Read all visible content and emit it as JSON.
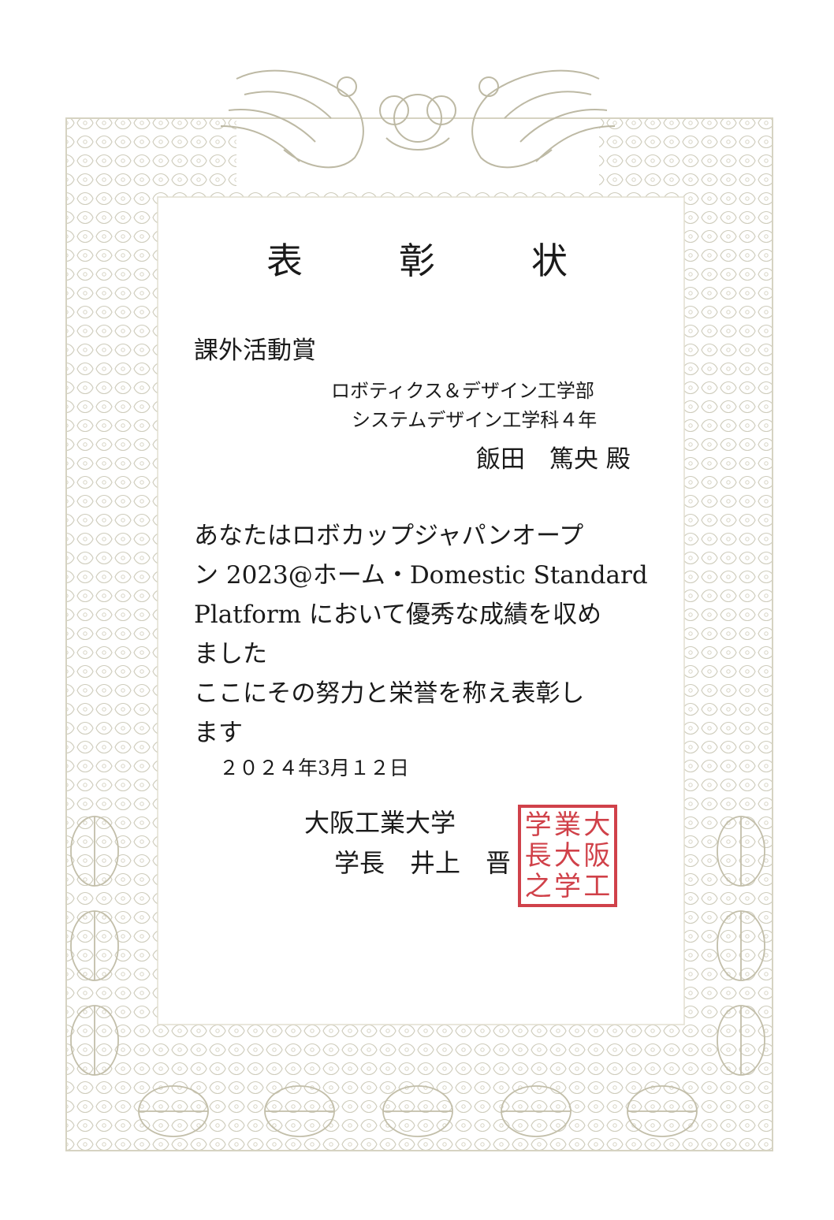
{
  "certificate": {
    "title": "表　彰　状",
    "award_name": "課外活動賞",
    "recipient": {
      "faculty": "ロボティクス＆デザイン工学部",
      "department": "システムデザイン工学科４年",
      "name": "飯田　篤央 殿"
    },
    "body_lines": [
      "あなたはロボカップジャパンオープ",
      "ン 2023@ホーム・Domestic Standard",
      "Platform において優秀な成績を収め",
      "ました",
      "ここにその努力と栄誉を称え表彰し",
      "ます"
    ],
    "date": "２０２４年3月１２日",
    "issuer": {
      "university": "大阪工業大学",
      "president": "学長　井上　晋"
    },
    "seal": {
      "text": "大阪工業大学学長之印",
      "color": "#c8202a"
    }
  }
}
